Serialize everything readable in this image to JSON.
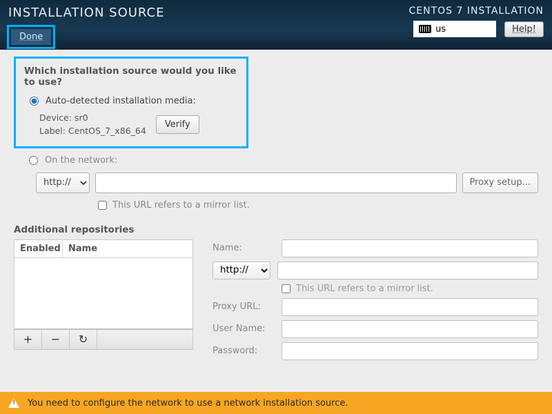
{
  "header": {
    "title": "INSTALLATION SOURCE",
    "subtitle": "CENTOS 7 INSTALLATION",
    "done": "Done",
    "keyboard": "us",
    "help": "Help!"
  },
  "source": {
    "question": "Which installation source would you like to use?",
    "auto_label": "Auto-detected installation media:",
    "device_label": "Device: sr0",
    "label_label": "Label: CentOS_7_x86_64",
    "verify": "Verify",
    "network_label": "On the network:",
    "protocol": "http://",
    "proxy_button": "Proxy setup...",
    "mirror_label": "This URL refers to a mirror list."
  },
  "additional": {
    "title": "Additional repositories",
    "col_enabled": "Enabled",
    "col_name": "Name",
    "add_icon": "+",
    "remove_icon": "−",
    "refresh_icon": "↻",
    "form": {
      "name_label": "Name:",
      "protocol": "http://",
      "mirror_label": "This URL refers to a mirror list.",
      "proxyurl_label": "Proxy URL:",
      "username_label": "User Name:",
      "password_label": "Password:"
    }
  },
  "warning": "You need to configure the network to use a network installation source."
}
